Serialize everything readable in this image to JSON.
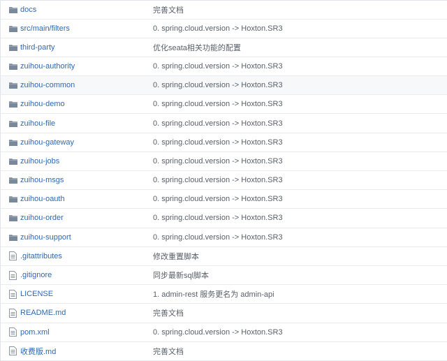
{
  "colors": {
    "link": "#2f69b3",
    "message": "#586069",
    "folder_icon": "#79889b",
    "file_icon": "#8d97a4",
    "hover_row": "#f6f8fa",
    "border": "#eaecef"
  },
  "files": [
    {
      "type": "folder",
      "icon": "folder-icon",
      "name": "docs",
      "message": "完善文档"
    },
    {
      "type": "folder",
      "icon": "folder-icon",
      "name": "src/main/filters",
      "message": "0. spring.cloud.version -> Hoxton.SR3"
    },
    {
      "type": "folder",
      "icon": "folder-icon",
      "name": "third-party",
      "message": "优化seata相关功能的配置"
    },
    {
      "type": "folder",
      "icon": "folder-icon",
      "name": "zuihou-authority",
      "message": "0. spring.cloud.version -> Hoxton.SR3"
    },
    {
      "type": "folder",
      "icon": "folder-icon",
      "name": "zuihou-common",
      "message": "0. spring.cloud.version -> Hoxton.SR3",
      "hovered": true
    },
    {
      "type": "folder",
      "icon": "folder-icon",
      "name": "zuihou-demo",
      "message": "0. spring.cloud.version -> Hoxton.SR3"
    },
    {
      "type": "folder",
      "icon": "folder-icon",
      "name": "zuihou-file",
      "message": "0. spring.cloud.version -> Hoxton.SR3"
    },
    {
      "type": "folder",
      "icon": "folder-icon",
      "name": "zuihou-gateway",
      "message": "0. spring.cloud.version -> Hoxton.SR3"
    },
    {
      "type": "folder",
      "icon": "folder-icon",
      "name": "zuihou-jobs",
      "message": "0. spring.cloud.version -> Hoxton.SR3"
    },
    {
      "type": "folder",
      "icon": "folder-icon",
      "name": "zuihou-msgs",
      "message": "0. spring.cloud.version -> Hoxton.SR3"
    },
    {
      "type": "folder",
      "icon": "folder-icon",
      "name": "zuihou-oauth",
      "message": "0. spring.cloud.version -> Hoxton.SR3"
    },
    {
      "type": "folder",
      "icon": "folder-icon",
      "name": "zuihou-order",
      "message": "0. spring.cloud.version -> Hoxton.SR3"
    },
    {
      "type": "folder",
      "icon": "folder-icon",
      "name": "zuihou-support",
      "message": "0. spring.cloud.version -> Hoxton.SR3"
    },
    {
      "type": "file",
      "icon": "file-icon",
      "name": ".gitattributes",
      "message": "修改重置脚本"
    },
    {
      "type": "file",
      "icon": "file-icon",
      "name": ".gitignore",
      "message": "同步最新sql脚本"
    },
    {
      "type": "file",
      "icon": "file-icon",
      "name": "LICENSE",
      "message": "1. admin-rest 服务更名为 admin-api"
    },
    {
      "type": "file",
      "icon": "file-icon",
      "name": "README.md",
      "message": "完善文档"
    },
    {
      "type": "file",
      "icon": "file-icon",
      "name": "pom.xml",
      "message": "0. spring.cloud.version -> Hoxton.SR3"
    },
    {
      "type": "file",
      "icon": "file-icon",
      "name": "收费版.md",
      "message": "完善文档"
    }
  ]
}
